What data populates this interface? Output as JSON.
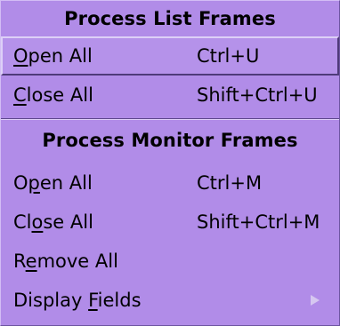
{
  "menu": {
    "colors": {
      "background": "#b18ce8",
      "text": "#000000",
      "submenu_arrow": "#d6c7f0"
    },
    "section1": {
      "title": "Process List Frames",
      "items": [
        {
          "label_pre": "",
          "mnemonic": "O",
          "label_post": "pen All",
          "shortcut": "Ctrl+U",
          "highlighted": true
        },
        {
          "label_pre": "",
          "mnemonic": "C",
          "label_post": "lose All",
          "shortcut": "Shift+Ctrl+U"
        }
      ]
    },
    "section2": {
      "title": "Process Monitor Frames",
      "items": [
        {
          "label_pre": "O",
          "mnemonic": "p",
          "label_post": "en All",
          "shortcut": "Ctrl+M"
        },
        {
          "label_pre": "Cl",
          "mnemonic": "o",
          "label_post": "se All",
          "shortcut": "Shift+Ctrl+M"
        },
        {
          "label_pre": "R",
          "mnemonic": "e",
          "label_post": "move All",
          "shortcut": ""
        },
        {
          "label_pre": "Display ",
          "mnemonic": "F",
          "label_post": "ields",
          "shortcut": "",
          "submenu_icon": "submenu-arrow-icon"
        }
      ]
    }
  }
}
